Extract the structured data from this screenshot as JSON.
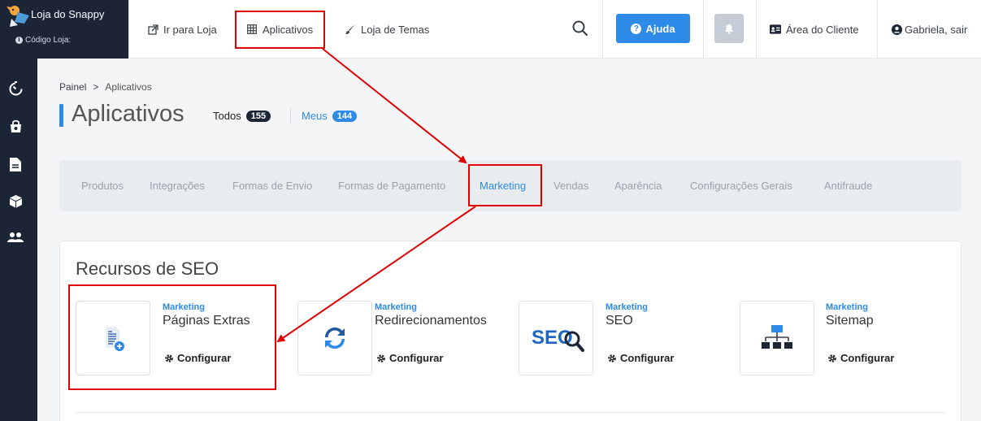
{
  "brand": {
    "name": "Loja do Snappy",
    "code_label": "Código Loja:"
  },
  "topnav": {
    "go_store": "Ir para Loja",
    "apps": "Aplicativos",
    "themes": "Loja de Temas",
    "help": "Ajuda",
    "client_area": "Área do Cliente",
    "user": "Gabriela, sair"
  },
  "breadcrumb": {
    "root": "Painel",
    "separator": ">",
    "current": "Aplicativos"
  },
  "page": {
    "title": "Aplicativos",
    "filters": [
      {
        "label": "Todos",
        "count": "155"
      },
      {
        "label": "Meus",
        "count": "144"
      }
    ]
  },
  "tabs": [
    "Produtos",
    "Integrações",
    "Formas de Envio",
    "Formas de Pagamento",
    "Marketing",
    "Vendas",
    "Aparência",
    "Configurações Gerais",
    "Antifraude"
  ],
  "active_tab": "Marketing",
  "section": {
    "title": "Recursos de SEO"
  },
  "cards": [
    {
      "category": "Marketing",
      "name": "Páginas Extras",
      "action": "Configurar",
      "icon": "document-plus-icon"
    },
    {
      "category": "Marketing",
      "name": "Redirecionamentos",
      "action": "Configurar",
      "icon": "sync-icon"
    },
    {
      "category": "Marketing",
      "name": "SEO",
      "action": "Configurar",
      "icon": "seo-magnifier-icon",
      "icon_text": "SEO"
    },
    {
      "category": "Marketing",
      "name": "Sitemap",
      "action": "Configurar",
      "icon": "sitemap-icon"
    }
  ],
  "colors": {
    "accent": "#2d8ae6",
    "sidebar": "#1b2536",
    "annotation": "#e10000",
    "pill_dark": "#1b2536"
  }
}
